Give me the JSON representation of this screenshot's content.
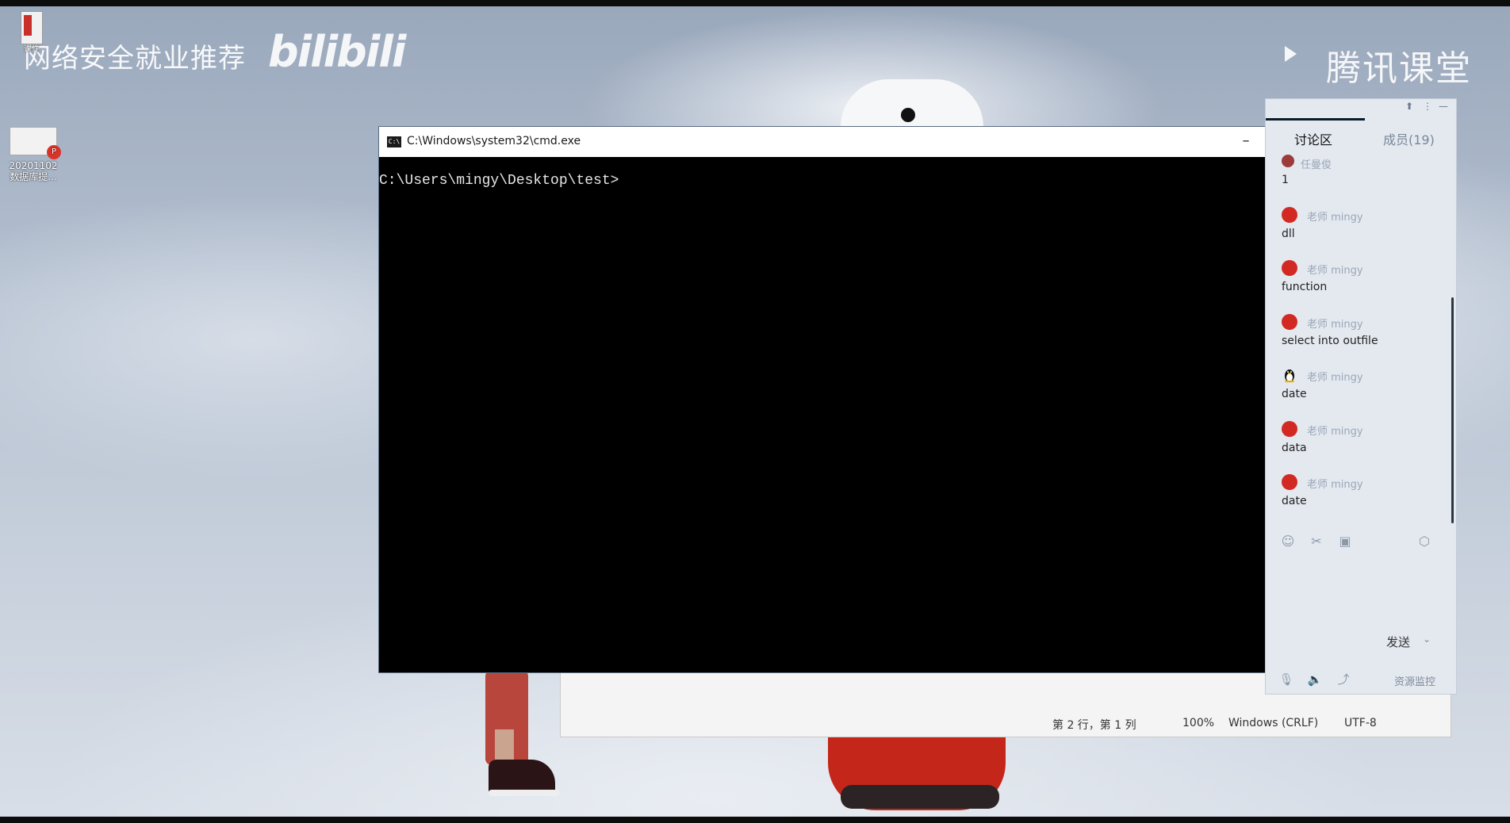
{
  "watermark": {
    "left_text": "网络安全就业推荐",
    "bili_text": "bilibili",
    "right_text": "腾讯课堂"
  },
  "desktop": {
    "icons": [
      {
        "label": "课件",
        "name": "shortcut-file-icon"
      },
      {
        "label": "20201102\n数据库提...",
        "name": "pdf-file-icon"
      }
    ]
  },
  "cmd": {
    "title": "C:\\Windows\\system32\\cmd.exe",
    "icon_label": "C:\\",
    "minimize_label": "–",
    "prompt": "C:\\Users\\mingy\\Desktop\\test>"
  },
  "notepad": {
    "status": {
      "position": "第 2 行，第 1 列",
      "zoom": "100%",
      "line_ending": "Windows (CRLF)",
      "encoding": "UTF-8"
    }
  },
  "chat": {
    "tabs": [
      {
        "label": "讨论区",
        "active": true
      },
      {
        "label": "成员(19)",
        "active": false
      }
    ],
    "partial_sender": "任曼俊",
    "partial_text": "1",
    "messages": [
      {
        "sender": "老师 mingy",
        "text": "dll",
        "avatar": "red"
      },
      {
        "sender": "老师 mingy",
        "text": "function",
        "avatar": "red"
      },
      {
        "sender": "老师 mingy",
        "text": "select into outfile",
        "avatar": "red"
      },
      {
        "sender": "老师 mingy",
        "text": "date",
        "avatar": "penguin"
      },
      {
        "sender": "老师 mingy",
        "text": "data",
        "avatar": "red"
      },
      {
        "sender": "老师 mingy",
        "text": "date",
        "avatar": "red"
      }
    ],
    "send_label": "发送",
    "resource_label": "资源监控"
  }
}
